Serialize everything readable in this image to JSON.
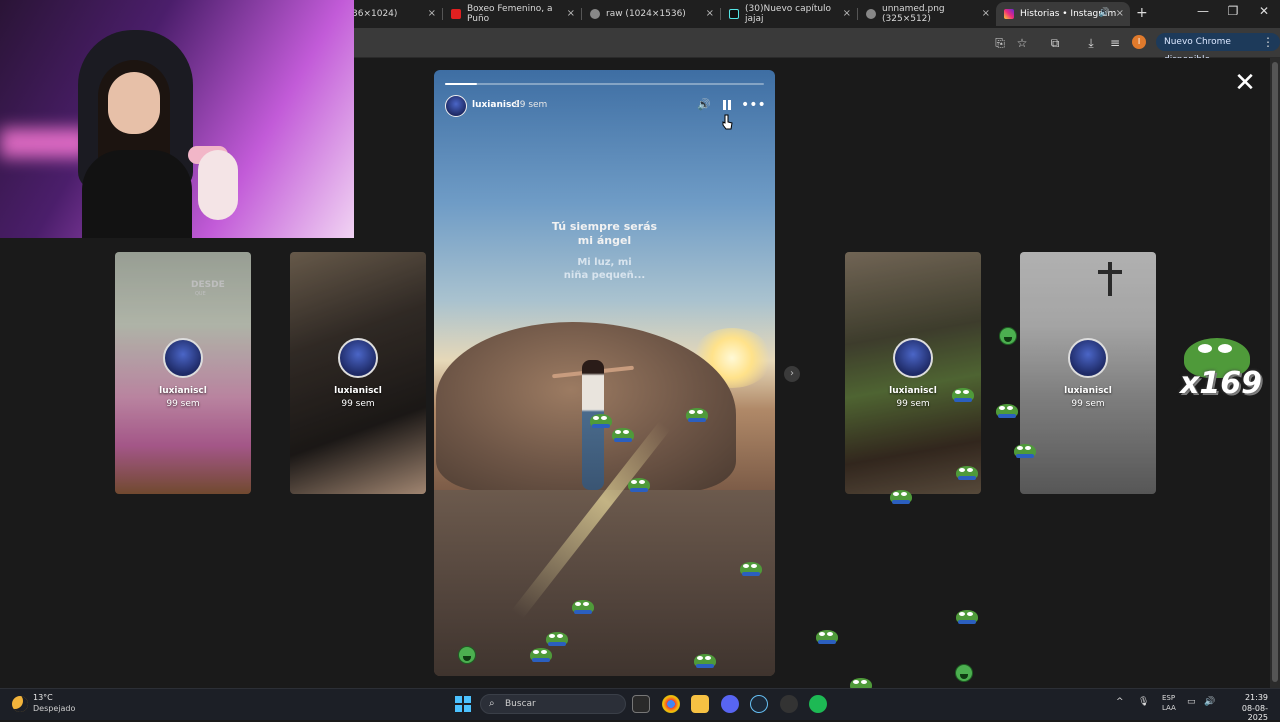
{
  "browser": {
    "tabs": [
      {
        "title": "36×1024)",
        "favicon": "image-icon",
        "color": "#3a3a3a"
      },
      {
        "title": "Boxeo Femenino, a Puño",
        "favicon": "youtube-icon",
        "color": "#e02020"
      },
      {
        "title": "raw (1024×1536)",
        "favicon": "globe-icon",
        "color": "#888888"
      },
      {
        "title": "(30)Nuevo capítulo jajaj",
        "favicon": "tiktok-icon",
        "color": "#111111"
      },
      {
        "title": "unnamed.png (325×512)",
        "favicon": "globe-icon",
        "color": "#888888"
      },
      {
        "title": "Historias • Instagram",
        "favicon": "instagram-icon",
        "color": "#d6249f",
        "active": true
      }
    ],
    "profile_initial": "I",
    "update_label": "Nuevo Chrome disponible",
    "tab_close": "×",
    "newtab": "+",
    "minimize": "—",
    "restore": "❐",
    "close": "✕",
    "kebab": "⋮"
  },
  "viewer": {
    "close_glyph": "✕",
    "next_glyph": "›",
    "main_story": {
      "username": "luxianiscl",
      "age": "99 sem",
      "progress": 0.1,
      "line1a": "Tú siempre serás",
      "line1b": "mi ángel",
      "line2a": "Mi luz, mi",
      "line2b": "niña pequeñ..."
    },
    "previews": [
      {
        "username": "luxianiscl",
        "age": "99 sem",
        "overlay_text": "DESDE",
        "overlay_sub": "QUE"
      },
      {
        "username": "luxianiscl",
        "age": "99 sem"
      },
      {
        "username": "luxianiscl",
        "age": "99 sem"
      },
      {
        "username": "luxianiscl",
        "age": "99 sem"
      }
    ]
  },
  "stream_overlay": {
    "emote_combo": "x169"
  },
  "taskbar": {
    "weather_temp": "13°C",
    "weather_desc": "Despejado",
    "search_placeholder": "Buscar",
    "lang_line1": "ESP",
    "lang_line2": "LAA",
    "time": "21:39",
    "date": "08-08-2025"
  }
}
